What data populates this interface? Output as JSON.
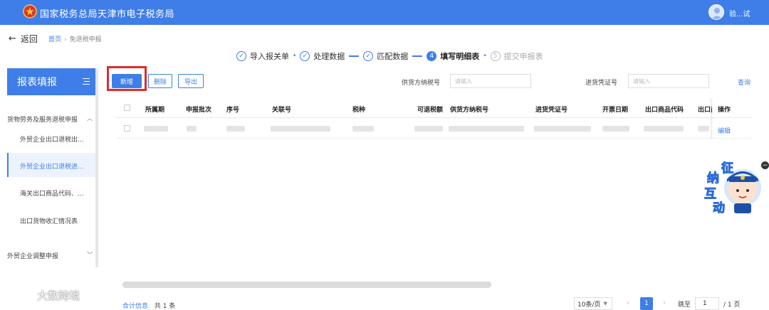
{
  "header": {
    "title": "国家税务总局天津市电子税务局",
    "user_name": "验...试"
  },
  "nav": {
    "back_label": "返回",
    "breadcrumb": [
      "首页",
      "免退税申报"
    ]
  },
  "steps": [
    {
      "num": "✓",
      "label": "导入报关单",
      "state": "done"
    },
    {
      "num": "✓",
      "label": "处理数据",
      "state": "done"
    },
    {
      "num": "✓",
      "label": "匹配数据",
      "state": "done"
    },
    {
      "num": "4",
      "label": "填写明细表",
      "state": "active"
    },
    {
      "num": "5",
      "label": "提交申报表",
      "state": "todo"
    }
  ],
  "sidebar": {
    "title": "报表填报",
    "groups": [
      {
        "label": "货物劳务及服务退税申报",
        "expanded": true
      },
      {
        "label": "外贸企业调整申报",
        "expanded": false
      }
    ],
    "items": [
      {
        "label": "外贸企业出口退税出..."
      },
      {
        "label": "外贸企业出口退税进..."
      },
      {
        "label": "海关出口商品代码、..."
      },
      {
        "label": "出口货物收汇情况表"
      }
    ]
  },
  "toolbar": {
    "add_label": "新增",
    "delete_label": "删除",
    "export_label": "导出"
  },
  "filters": {
    "supplier_label": "供货方纳税号",
    "supplier_placeholder": "请输入",
    "voucher_label": "进货凭证号",
    "voucher_placeholder": "请输入",
    "query_label": "查询"
  },
  "table": {
    "columns": [
      "所属期",
      "申报批次",
      "序号",
      "关联号",
      "税种",
      "可退税额",
      "供货方纳税号",
      "进货凭证号",
      "开票日期",
      "出口商品代码",
      "出口商",
      "操作"
    ],
    "row_action": "编辑"
  },
  "pagination": {
    "total_link": "合计信息",
    "total_text": "共 1 条",
    "page_size": "10条/页",
    "current_page": "1",
    "jump_label": "跳至",
    "jump_value": "1",
    "total_pages": "/ 1 页"
  },
  "mascot": {
    "chars": [
      "征",
      "纳",
      "互",
      "动"
    ]
  },
  "watermark": {
    "text": "大数跨境"
  },
  "colors": {
    "brand": "#3f7ee8",
    "highlight": "#e02a2a"
  }
}
